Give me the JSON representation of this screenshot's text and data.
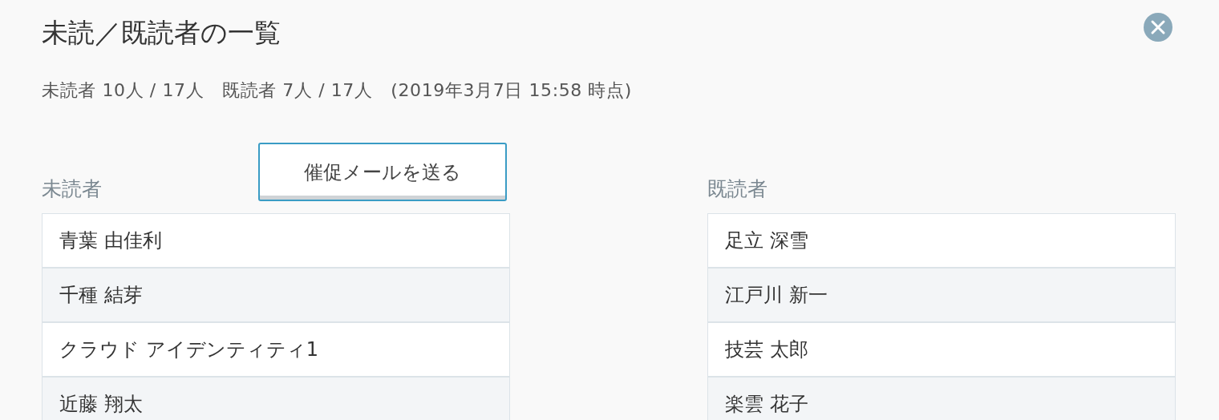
{
  "dialog": {
    "title": "未読／既読者の一覧",
    "summary": "未読者 10人 / 17人   既読者 7人 / 17人   (2019年3月7日 15:58 時点)"
  },
  "unread": {
    "heading": "未読者",
    "button": "催促メールを送る",
    "names": [
      "青葉 由佳利",
      "千種 結芽",
      "クラウド アイデンティティ1",
      "近藤 翔太"
    ]
  },
  "read": {
    "heading": "既読者",
    "names": [
      "足立 深雪",
      "江戸川 新一",
      "技芸 太郎",
      "楽雲 花子"
    ]
  }
}
